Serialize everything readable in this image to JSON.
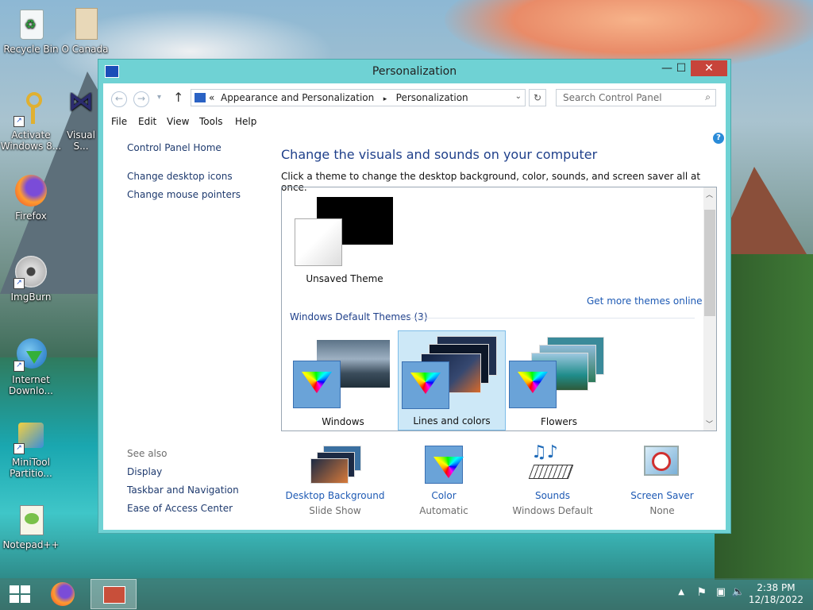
{
  "desktop": {
    "icons": [
      {
        "label": "Recycle Bin",
        "icon": "recycle-bin-icon"
      },
      {
        "label": "O Canada",
        "icon": "file-icon"
      },
      {
        "label": "Activate Windows 8...",
        "icon": "key-icon"
      },
      {
        "label": "Visual S...",
        "icon": "visual-studio-icon"
      },
      {
        "label": "Firefox",
        "icon": "firefox-icon"
      },
      {
        "label": "ImgBurn",
        "icon": "disc-icon"
      },
      {
        "label": "Internet Downlo...",
        "icon": "globe-download-icon"
      },
      {
        "label": "MiniTool Partitio...",
        "icon": "minitool-icon"
      },
      {
        "label": "Notepad++",
        "icon": "notepad-plus-icon"
      }
    ]
  },
  "window": {
    "title": "Personalization",
    "minimize": "—",
    "maximize": "☐",
    "close": "✕",
    "address": {
      "prefix": "«",
      "crumb1": "Appearance and Personalization",
      "sep": "▸",
      "crumb2": "Personalization"
    },
    "search_placeholder": "Search Control Panel",
    "menu": [
      "File",
      "Edit",
      "View",
      "Tools",
      "Help"
    ],
    "left_nav": [
      "Control Panel Home",
      "Change desktop icons",
      "Change mouse pointers"
    ],
    "see_also_title": "See also",
    "see_also": [
      "Display",
      "Taskbar and Navigation",
      "Ease of Access Center"
    ],
    "heading": "Change the visuals and sounds on your computer",
    "subheading": "Click a theme to change the desktop background, color, sounds, and screen saver all at once.",
    "help": "?",
    "my_theme": "Unsaved Theme",
    "get_more": "Get more themes online",
    "default_group": "Windows Default Themes (3)",
    "themes": [
      "Windows",
      "Lines and colors",
      "Flowers"
    ],
    "selected_theme": "Lines and colors",
    "bottom": [
      {
        "title": "Desktop Background",
        "value": "Slide Show"
      },
      {
        "title": "Color",
        "value": "Automatic"
      },
      {
        "title": "Sounds",
        "value": "Windows Default"
      },
      {
        "title": "Screen Saver",
        "value": "None"
      }
    ]
  },
  "taskbar": {
    "time": "2:38 PM",
    "date": "12/18/2022"
  },
  "colors": {
    "window_frame": "#6fd2d4",
    "close_button": "#c7443a",
    "link": "#1e3a6e",
    "heading": "#1e3f8a",
    "selection": "#cde8f7"
  }
}
